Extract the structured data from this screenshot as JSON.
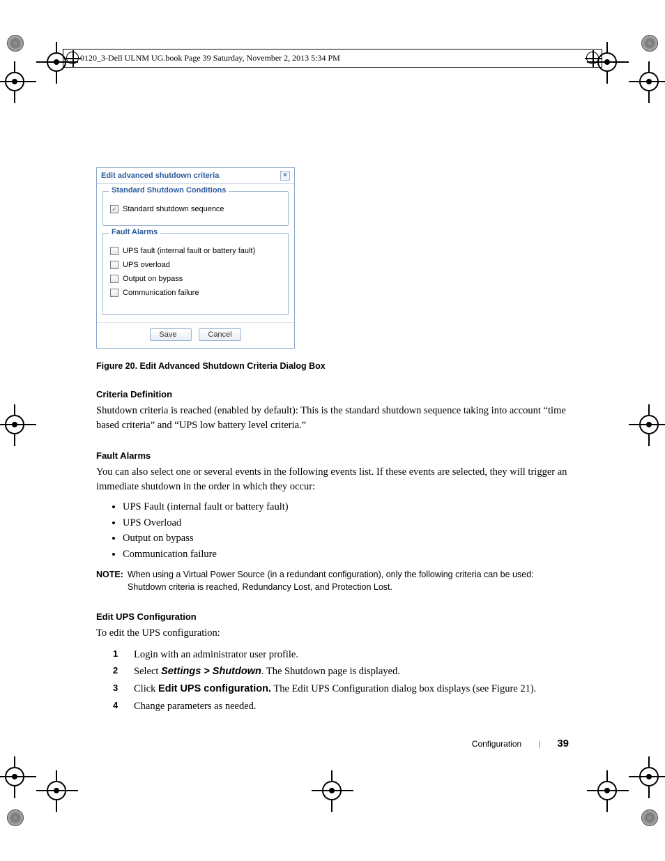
{
  "header_running": "0120_3-Dell ULNM UG.book  Page 39  Saturday, November 2, 2013  5:34 PM",
  "dialog": {
    "title": "Edit advanced shutdown criteria",
    "close_glyph": "×",
    "group1_legend": "Standard Shutdown Conditions",
    "group1_item": "Standard shutdown sequence",
    "group2_legend": "Fault Alarms",
    "group2_items": {
      "a": "UPS fault (internal fault or battery fault)",
      "b": "UPS overload",
      "c": "Output on bypass",
      "d": "Communication failure"
    },
    "save": "Save",
    "cancel": "Cancel"
  },
  "figure_caption": "Figure 20.  Edit Advanced Shutdown Criteria Dialog Box",
  "criteria_def_heading": "Criteria Definition",
  "criteria_def_body": "Shutdown criteria is reached (enabled by default): This is the standard shutdown sequence taking into account “time based criteria” and “UPS low battery level criteria.”",
  "fault_heading": "Fault Alarms",
  "fault_body": "You can also select one or several events in the following events list. If these events are selected, they will trigger an immediate shutdown in the order in which they occur:",
  "fault_list": {
    "a": "UPS Fault (internal fault or battery fault)",
    "b": "UPS Overload",
    "c": "Output on bypass",
    "d": "Communication failure"
  },
  "note_label": "NOTE:",
  "note_body": "When using a Virtual Power Source (in a redundant configuration), only the following criteria can be used: Shutdown criteria is reached, Redundancy Lost, and Protection Lost.",
  "edit_ups_heading": "Edit UPS Configuration",
  "edit_ups_intro": "To edit the UPS configuration:",
  "steps": {
    "s1": "Login with an administrator user profile.",
    "s2_pre": "Select ",
    "s2_bold": "Settings > Shutdown",
    "s2_post": ". The Shutdown page is displayed.",
    "s3_pre": "Click ",
    "s3_bold": "Edit UPS configuration.",
    "s3_post": " The Edit UPS Configuration dialog box displays (see Figure 21).",
    "s4": "Change parameters as needed."
  },
  "footer_section": "Configuration",
  "footer_page": "39"
}
